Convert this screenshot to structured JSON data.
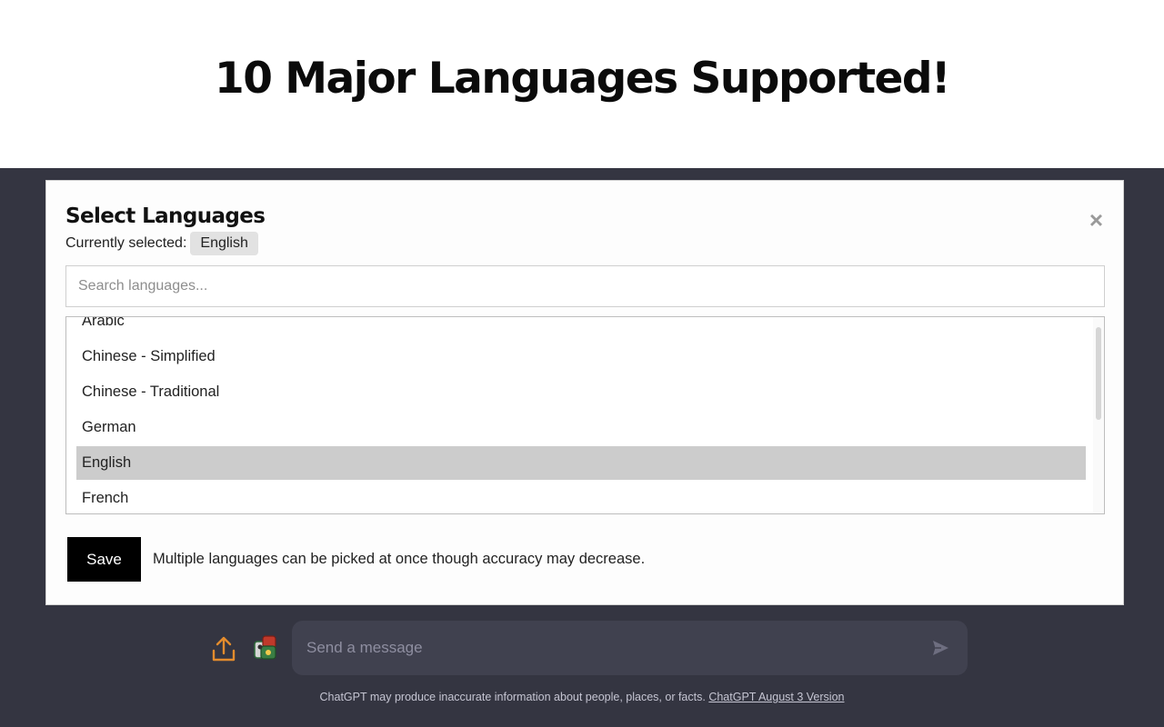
{
  "banner": {
    "title": "10 Major Languages Supported!"
  },
  "modal": {
    "title": "Select Languages",
    "close_label": "×",
    "current_label": "Currently selected:",
    "current_value": "English",
    "search_placeholder": "Search languages...",
    "languages": [
      {
        "label": "Arabic",
        "selected": false
      },
      {
        "label": "Chinese - Simplified",
        "selected": false
      },
      {
        "label": "Chinese - Traditional",
        "selected": false
      },
      {
        "label": "German",
        "selected": false
      },
      {
        "label": "English",
        "selected": true
      },
      {
        "label": "French",
        "selected": false
      }
    ],
    "save_label": "Save",
    "hint": "Multiple languages can be picked at once though accuracy may decrease."
  },
  "chat": {
    "input_placeholder": "Send a message",
    "disclaimer": "ChatGPT may produce inaccurate information about people, places, or facts.",
    "version_link": "ChatGPT August 3 Version"
  },
  "icons": {
    "upload": "upload-icon",
    "plugin": "plugin-icon",
    "send": "send-icon",
    "close": "close-icon"
  },
  "colors": {
    "app_background": "#343541",
    "input_background": "#40414f",
    "upload_icon": "#e38c2d",
    "selected_row": "#cccccc",
    "save_button": "#000000"
  }
}
